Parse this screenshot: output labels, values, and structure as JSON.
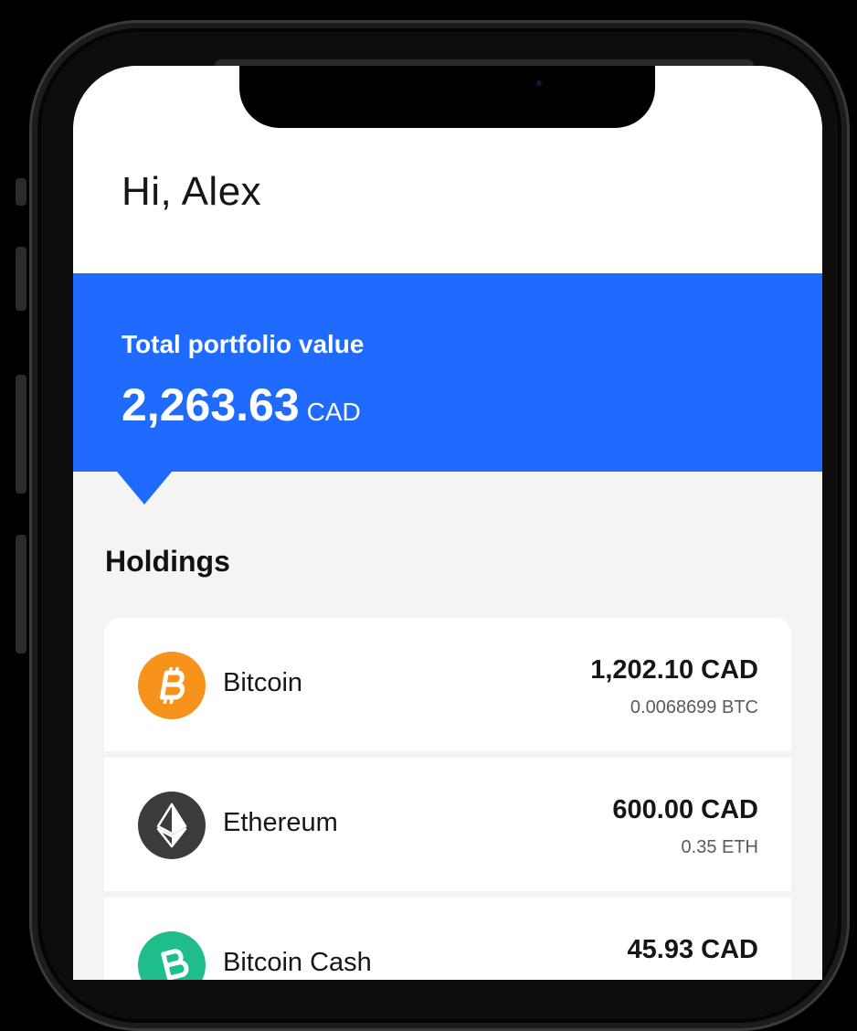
{
  "greeting": "Hi, Alex",
  "portfolio": {
    "label": "Total portfolio value",
    "value": "2,263.63",
    "currency": "CAD"
  },
  "holdings": {
    "title": "Holdings",
    "items": [
      {
        "name": "Bitcoin",
        "value": "1,202.10 CAD",
        "amount": "0.0068699 BTC",
        "icon": "bitcoin-icon",
        "color": "#f7931a"
      },
      {
        "name": "Ethereum",
        "value": "600.00 CAD",
        "amount": "0.35 ETH",
        "icon": "ethereum-icon",
        "color": "#3c3c3d"
      },
      {
        "name": "Bitcoin Cash",
        "value": "45.93 CAD",
        "amount": "",
        "icon": "bitcoin-cash-icon",
        "color": "#1fbd8c"
      }
    ]
  },
  "colors": {
    "accent": "#1f6bff",
    "background": "#f4f4f4"
  }
}
